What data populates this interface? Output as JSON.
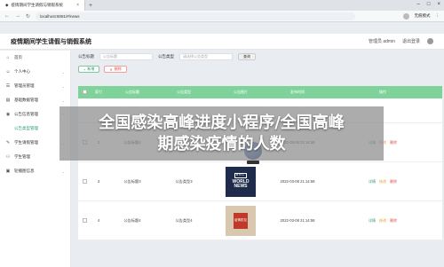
{
  "browser": {
    "tab_title": "疫情期间学生请假与销假系统",
    "url": "localhost:8081/#/news",
    "profile_label": "无痕模式"
  },
  "header": {
    "title": "疫情期间学生请假与销假系统",
    "user": "管理员 admin",
    "logout": "退出登录"
  },
  "sidebar": {
    "items": [
      {
        "label": "首页"
      },
      {
        "label": "个人中心"
      },
      {
        "label": "管理员管理"
      },
      {
        "label": "基础数据管理"
      },
      {
        "label": "公告信息管理"
      },
      {
        "label": "公告类型管理"
      },
      {
        "label": "学生请假管理"
      },
      {
        "label": "学生管理"
      },
      {
        "label": "轮播图信息"
      }
    ]
  },
  "filters": {
    "title_label": "公告标题",
    "title_placeholder": "公告标题",
    "type_label": "公告类型",
    "type_placeholder": "请选择公告类型",
    "search": "查询"
  },
  "actions": {
    "add": "新增",
    "delete": "删除"
  },
  "table": {
    "headers": [
      "",
      "索引",
      "公告标题",
      "公告类型",
      "公告图片",
      "发布时间",
      "操作"
    ],
    "rows": [
      {
        "index": "2",
        "title": "公告标题2",
        "type": "公告类型2",
        "image": "globe",
        "time": "2022-03-08 21:14:58"
      },
      {
        "index": "3",
        "title": "公告标题3",
        "type": "公告类型3",
        "image": "bbc",
        "time": "2022-03-08 21:14:58"
      },
      {
        "index": "4",
        "title": "公告标题4",
        "type": "公告类型4",
        "image": "poster",
        "time": "2022-03-08 21:14:58"
      }
    ],
    "op_detail": "详情",
    "op_edit": "修改",
    "op_delete": "删除",
    "bbc_line1": "BBC",
    "bbc_line2": "WORLD",
    "bbc_line3": "NEWS",
    "poster_text": "疫情防控"
  },
  "overlay": {
    "line1": "全国感染高峰进度小程序/全国高峰",
    "line2": "期感染疫情的人数"
  },
  "colors": {
    "accent": "#2e9b6e",
    "table_header": "#7fd39a",
    "danger": "#e05050",
    "warning": "#e6a23c"
  }
}
